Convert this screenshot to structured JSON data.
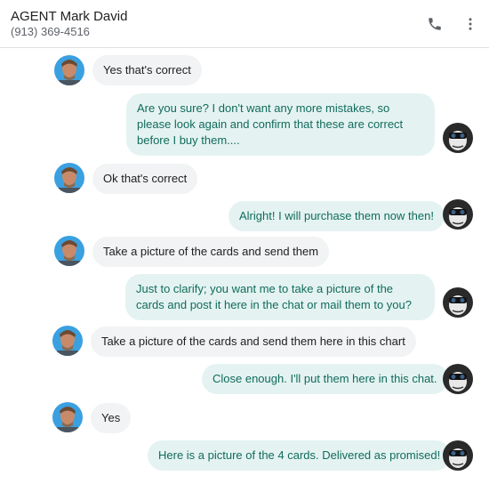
{
  "header": {
    "contact_name": "AGENT Mark David",
    "contact_phone": "(913) 369-4516",
    "call_icon": "phone-icon",
    "more_icon": "more-vert-icon"
  },
  "colors": {
    "incoming_bg": "#f1f3f4",
    "outgoing_bg": "#e4f3f1",
    "outgoing_text": "#116b5d"
  },
  "messages": [
    {
      "direction": "incoming",
      "text": "Yes that's correct"
    },
    {
      "direction": "outgoing",
      "text": "Are you sure? I don't want any more mistakes, so please look again and confirm that these are correct before I buy them...."
    },
    {
      "direction": "incoming",
      "text": "Ok that's correct"
    },
    {
      "direction": "outgoing",
      "text": "Alright! I will purchase them now then!"
    },
    {
      "direction": "incoming",
      "text": "Take a picture of the cards and send them"
    },
    {
      "direction": "outgoing",
      "text": "Just to clarify; you want me to take a picture of the cards and post it here in the chat or mail them to you?"
    },
    {
      "direction": "incoming",
      "text": "Take a picture of the cards and send them here in this chart"
    },
    {
      "direction": "outgoing",
      "text": "Close enough. I'll put them here in this chat."
    },
    {
      "direction": "incoming",
      "text": "Yes"
    },
    {
      "direction": "outgoing",
      "text": "Here is a picture of the 4 cards. Delivered as promised!"
    }
  ]
}
